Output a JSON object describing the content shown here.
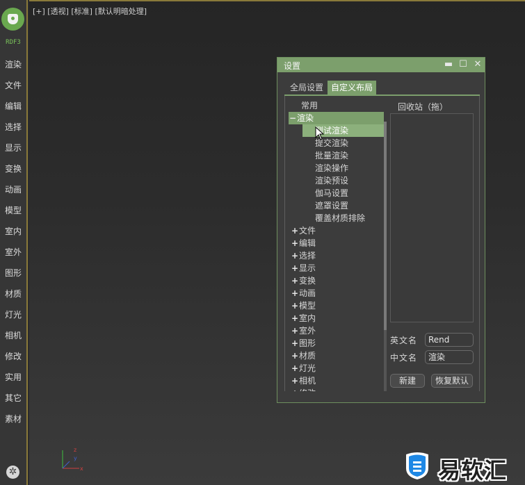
{
  "sidebar": {
    "brand": "RDF3",
    "items": [
      "渲染",
      "文件",
      "编辑",
      "选择",
      "显示",
      "变换",
      "动画",
      "模型",
      "室内",
      "室外",
      "图形",
      "材质",
      "灯光",
      "相机",
      "修改",
      "实用",
      "其它",
      "素材"
    ]
  },
  "viewport": {
    "label": "[+] [透视] [标准] [默认明暗处理]",
    "axis": {
      "x": "x",
      "y": "y",
      "z": "z"
    }
  },
  "dialog": {
    "title": "设置",
    "tabs": [
      "全局设置",
      "自定义布局"
    ],
    "active_tab": "自定义布局",
    "tree": {
      "common": "常用",
      "expanded": "渲染",
      "children": [
        "测试渲染",
        "提交渲染",
        "批量渲染",
        "渲染操作",
        "渲染预设",
        "伽马设置",
        "遮罩设置",
        "覆盖材质排除"
      ],
      "selected_child": "测试渲染",
      "collapsed": [
        "文件",
        "编辑",
        "选择",
        "显示",
        "变换",
        "动画",
        "模型",
        "室内",
        "室外",
        "图形",
        "材质",
        "灯光",
        "相机",
        "修改"
      ]
    },
    "recycle_label": "回收站（拖）",
    "english_name_label": "英文名",
    "english_name_value": "Rend",
    "chinese_name_label": "中文名",
    "chinese_name_value": "渲染",
    "new_button": "新建",
    "reset_button": "恢复默认"
  },
  "watermark": {
    "text": "易软汇"
  },
  "colors": {
    "accent": "#7c9f6c",
    "logo": "#6aa84f",
    "border": "#8a7a3a"
  }
}
